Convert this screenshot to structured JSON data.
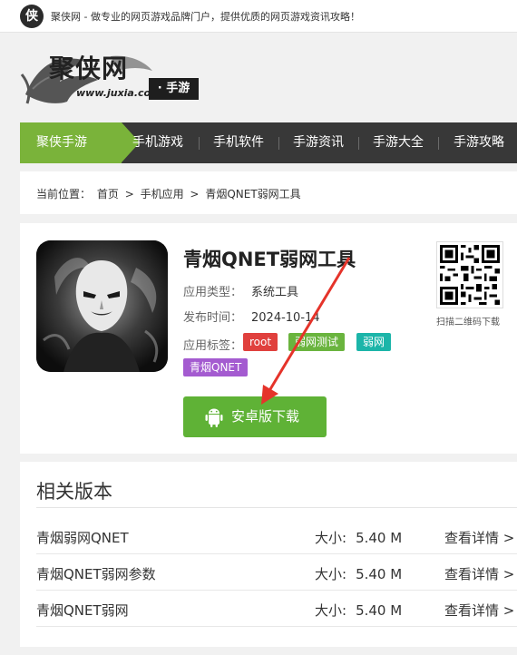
{
  "topbar": {
    "logo_char": "侠",
    "slogan": "聚侠网 - 做专业的网页游戏品牌门户，提供优质的网页游戏资讯攻略！"
  },
  "brand": {
    "name": "聚侠网",
    "url": "www.juxia.com",
    "badge": "· 手游"
  },
  "nav": {
    "active": "聚侠手游",
    "items": [
      "手机游戏",
      "手机软件",
      "手游资讯",
      "手游大全",
      "手游攻略"
    ]
  },
  "breadcrumb": {
    "label": "当前位置：",
    "items": [
      "首页",
      ">",
      "手机应用",
      ">",
      "青烟QNET弱网工具"
    ]
  },
  "app": {
    "title": "青烟QNET弱网工具",
    "type_label": "应用类型：",
    "type_value": "系统工具",
    "date_label": "发布时间：",
    "date_value": "2024-10-14",
    "tags_label": "应用标签：",
    "tags": [
      {
        "text": "root",
        "color": "#e0403d"
      },
      {
        "text": "弱网测试",
        "color": "#6ab43e"
      },
      {
        "text": "弱网",
        "color": "#1cb5a9"
      },
      {
        "text": "青烟QNET",
        "color": "#a45bd0"
      }
    ],
    "download_label": "安卓版下载",
    "qr_caption": "扫描二维码下载"
  },
  "related": {
    "title": "相关版本",
    "size_label": "大小:",
    "link_label": "查看详情 >",
    "rows": [
      {
        "name": "青烟弱网QNET",
        "size": "5.40 M"
      },
      {
        "name": "青烟QNET弱网参数",
        "size": "5.40 M"
      },
      {
        "name": "青烟QNET弱网",
        "size": "5.40 M"
      }
    ]
  },
  "colors": {
    "accent_green": "#7ab33a",
    "download_green": "#5fb236",
    "nav_bg": "#383838",
    "arrow_red": "#e5332a"
  }
}
